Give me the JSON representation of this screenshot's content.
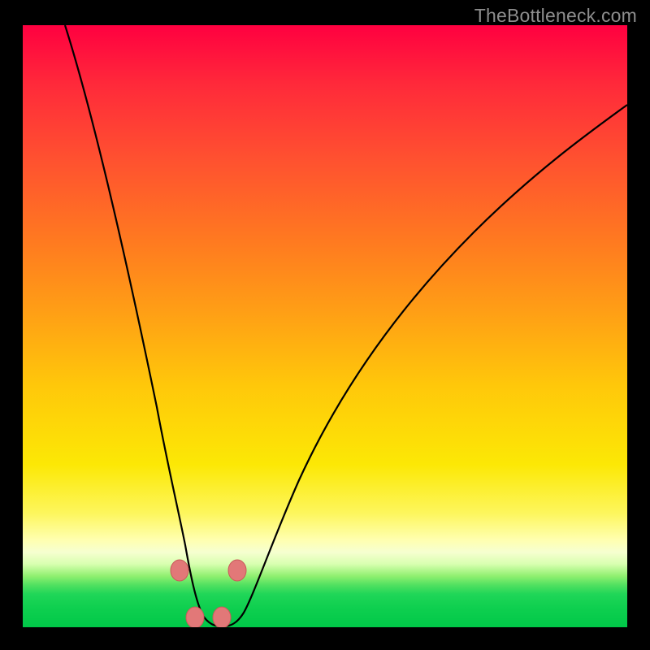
{
  "watermark": "TheBottleneck.com",
  "colors": {
    "frame": "#000000",
    "curve": "#000000",
    "markers_fill": "#e27878",
    "markers_stroke": "#c95a5a",
    "watermark": "#8d8d8d"
  },
  "chart_data": {
    "type": "line",
    "title": "",
    "xlabel": "",
    "ylabel": "",
    "xlim": [
      0,
      100
    ],
    "ylim": [
      0,
      100
    ],
    "grid": false,
    "series": [
      {
        "name": "bottleneck-curve",
        "x": [
          7,
          10,
          13,
          16,
          19,
          22,
          24.5,
          27,
          28.5,
          30,
          33,
          36,
          42,
          50,
          58,
          66,
          74,
          82,
          90,
          98,
          100
        ],
        "y": [
          100,
          82,
          66,
          50,
          35,
          21,
          12,
          4,
          1,
          0,
          0,
          4,
          17,
          34,
          48,
          59,
          68,
          75,
          81,
          86,
          87
        ]
      }
    ],
    "markers": [
      {
        "x": 26.0,
        "y": 9.0
      },
      {
        "x": 28.5,
        "y": 1.4
      },
      {
        "x": 33.0,
        "y": 1.4
      },
      {
        "x": 35.5,
        "y": 9.0
      }
    ],
    "annotations": []
  }
}
